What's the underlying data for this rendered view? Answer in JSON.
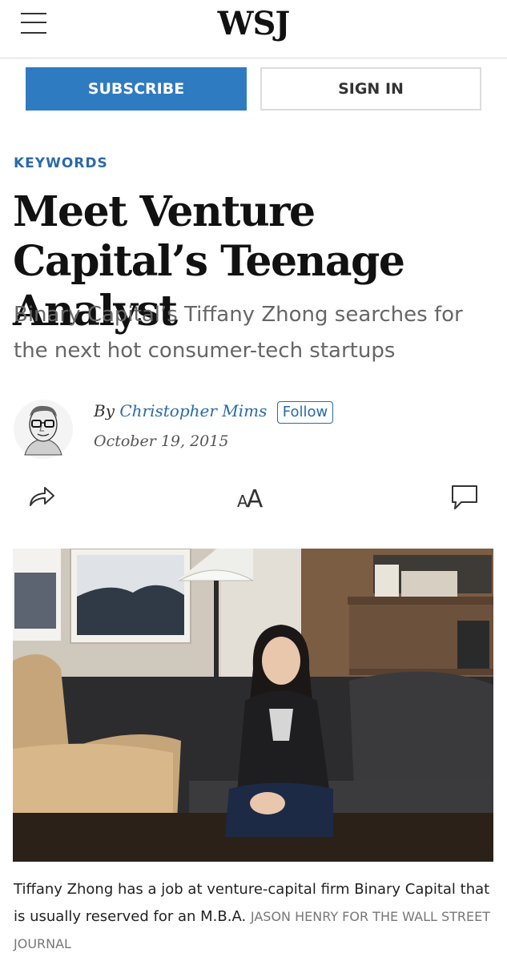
{
  "header": {
    "logo": "WSJ"
  },
  "actions": {
    "subscribe_label": "SUBSCRIBE",
    "signin_label": "SIGN IN"
  },
  "article": {
    "section": "KEYWORDS",
    "headline": "Meet Venture Capital’s Teenage Analyst",
    "dek": "Binary Capital’s Tiffany Zhong searches for the next hot consumer-tech startups",
    "byline_prefix": "By",
    "author": "Christopher Mims",
    "follow_label": "Follow",
    "date": "October 19, 2015",
    "caption": "Tiffany Zhong has a job at venture-capital firm Binary Capital that is usually reserved for an M.B.A.",
    "credit": "JASON HENRY FOR THE WALL STREET JOURNAL"
  },
  "toolbar": {
    "text_size_label": "AA"
  },
  "icons": {
    "menu": "hamburger-menu-icon",
    "share": "share-arrow-icon",
    "text_size": "text-size-icon",
    "comment": "comment-bubble-icon"
  },
  "colors": {
    "accent": "#2f7bc1",
    "link": "#2a6aa8"
  }
}
